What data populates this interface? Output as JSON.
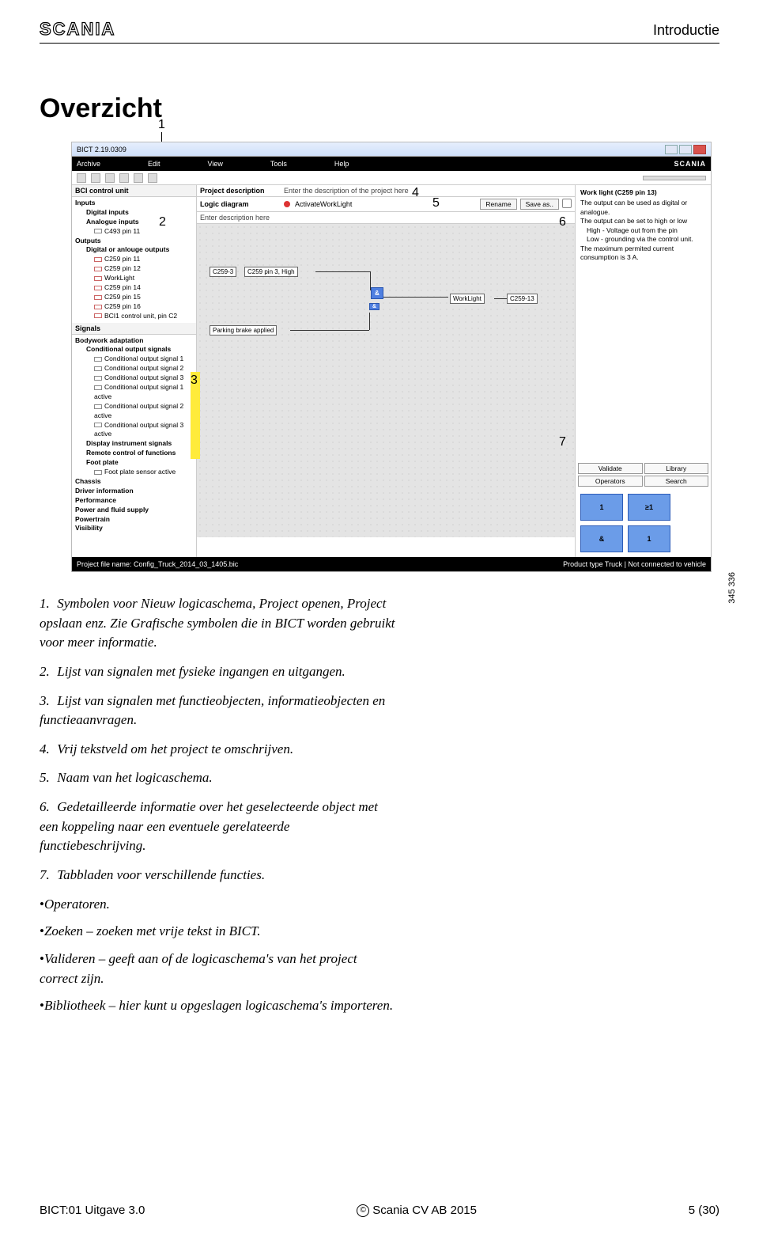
{
  "header": {
    "brand": "SCANIA",
    "section": "Introductie"
  },
  "title": "Overzicht",
  "screenshot": {
    "wintitle": "BICT 2.19.0309",
    "menu": [
      "Archive",
      "Edit",
      "View",
      "Tools",
      "Help"
    ],
    "brand": "SCANIA",
    "left": {
      "header": "BCI control unit",
      "groups": [
        {
          "label": "Inputs",
          "bold": true
        },
        {
          "label": "Digital inputs",
          "indent": 1,
          "bold": true
        },
        {
          "label": "Analogue inputs",
          "indent": 1,
          "bold": true
        },
        {
          "label": "C493 pin 11",
          "indent": 2,
          "pin": true
        },
        {
          "label": "Outputs",
          "bold": true
        },
        {
          "label": "Digital or anlouge outputs",
          "indent": 1,
          "bold": true
        },
        {
          "label": "C259 pin 11",
          "indent": 2,
          "pin": true,
          "out": true
        },
        {
          "label": "C259 pin 12",
          "indent": 2,
          "pin": true,
          "out": true
        },
        {
          "label": "WorkLight",
          "indent": 2,
          "pin": true,
          "out": true
        },
        {
          "label": "C259 pin 14",
          "indent": 2,
          "pin": true,
          "out": true
        },
        {
          "label": "C259 pin 15",
          "indent": 2,
          "pin": true,
          "out": true
        },
        {
          "label": "C259 pin 16",
          "indent": 2,
          "pin": true,
          "out": true
        },
        {
          "label": "BCI1 control unit, pin C2",
          "indent": 2,
          "pin": true,
          "out": true
        }
      ],
      "signals_header": "Signals",
      "signal_groups": [
        {
          "label": "Bodywork adaptation",
          "bold": true
        },
        {
          "label": "Conditional output signals",
          "indent": 1,
          "bold": true
        },
        {
          "label": "Conditional output signal 1",
          "indent": 2,
          "pin": true
        },
        {
          "label": "Conditional output signal 2",
          "indent": 2,
          "pin": true
        },
        {
          "label": "Conditional output signal 3",
          "indent": 2,
          "pin": true
        },
        {
          "label": "Conditional output signal 1 active",
          "indent": 2,
          "pin": true
        },
        {
          "label": "Conditional output signal 2 active",
          "indent": 2,
          "pin": true
        },
        {
          "label": "Conditional output signal 3 active",
          "indent": 2,
          "pin": true
        },
        {
          "label": "Display instrument signals",
          "indent": 1,
          "bold": true
        },
        {
          "label": "Remote control of functions",
          "indent": 1,
          "bold": true
        },
        {
          "label": "Foot plate",
          "indent": 1,
          "bold": true
        },
        {
          "label": "Foot plate sensor active",
          "indent": 2,
          "pin": true
        },
        {
          "label": "Chassis",
          "bold": true
        },
        {
          "label": "Driver information",
          "bold": true
        },
        {
          "label": "Performance",
          "bold": true
        },
        {
          "label": "Power and fluid supply",
          "bold": true
        },
        {
          "label": "Powertrain",
          "bold": true
        },
        {
          "label": "Visibility",
          "bold": true
        }
      ]
    },
    "center": {
      "row1_label": "Project description",
      "row1_value": "Enter the description of the project here",
      "row2_label": "Logic diagram",
      "row2_name": "ActivateWorkLight",
      "row2_btn1": "Rename",
      "row2_btn2": "Save as..",
      "row3_value": "Enter description here",
      "nodes": {
        "c259_3": "C259-3",
        "high": "C259 pin 3, High",
        "amp1": "&",
        "amp2": "&",
        "pbrake": "Parking brake applied",
        "worklight": "WorkLight",
        "c259_13": "C259-13"
      }
    },
    "right": {
      "title": "Work light (C259 pin 13)",
      "lines": [
        "The output can be used as digital or analogue.",
        "The output can be set to high or low",
        "High - Voltage out from the pin",
        "Low - grounding via the control unit.",
        "The maximum permited current consumption is 3 A."
      ],
      "tabs": [
        "Validate",
        "Library",
        "Operators",
        "Search"
      ],
      "ops": [
        "1",
        "≥1",
        "&",
        "1"
      ]
    },
    "status_left": "Project file name: Config_Truck_2014_03_1405.bic",
    "status_right": "Product type Truck | Not connected to vehicle",
    "sidecode": "345 336",
    "callouts": {
      "c1": "1",
      "c2": "2",
      "c3": "3",
      "c4": "4",
      "c5": "5",
      "c6": "6",
      "c7": "7"
    }
  },
  "legend": {
    "items": [
      "Symbolen voor Nieuw logicaschema, Project openen, Project opslaan enz. Zie Grafische symbolen die in BICT worden gebruikt voor meer informatie.",
      "Lijst van signalen met fysieke ingangen en uitgangen.",
      "Lijst van signalen met functieobjecten, informatieobjecten en functieaanvragen.",
      "Vrij tekstveld om het project te omschrijven.",
      "Naam van het logicaschema.",
      "Gedetailleerde informatie over het geselecteerde object met een koppeling naar een eventuele gerelateerde functiebeschrijving.",
      "Tabbladen voor verschillende functies."
    ],
    "bullets": [
      "Operatoren.",
      "Zoeken – zoeken met vrije tekst in BICT.",
      "Valideren – geeft aan of de logicaschema's van het project correct zijn.",
      "Bibliotheek – hier kunt u opgeslagen logicaschema's importeren."
    ]
  },
  "footer": {
    "left": "BICT:01 Uitgave 3.0",
    "center": "Scania CV AB 2015",
    "right": "5 (30)",
    "copy": "©"
  }
}
